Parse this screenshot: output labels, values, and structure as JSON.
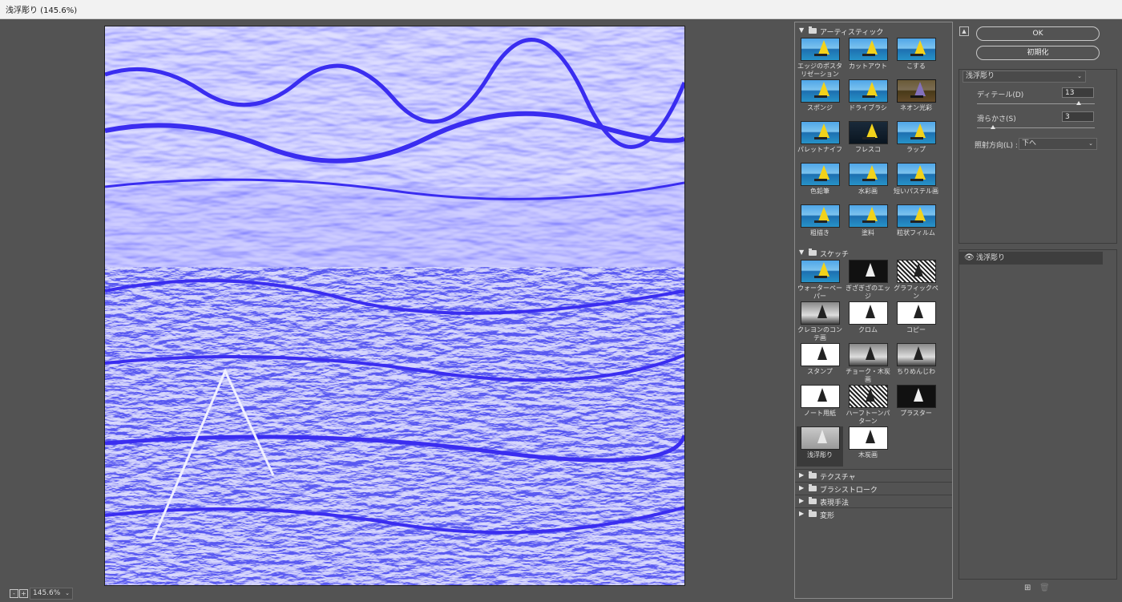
{
  "window": {
    "title": "浅浮彫り (145.6%)"
  },
  "preview": {
    "zoom": "145.6%",
    "minus": "-",
    "plus": "+"
  },
  "gallery": {
    "artistic": {
      "label": "アーティスティック",
      "items": [
        "エッジのポスタリゼーション",
        "カットアウト",
        "こする",
        "スポンジ",
        "ドライブラシ",
        "ネオン光彩",
        "パレットナイフ",
        "フレスコ",
        "ラップ",
        "色鉛筆",
        "水彩画",
        "短いパステル画",
        "粗描き",
        "塗料",
        "粒状フィルム"
      ]
    },
    "sketch": {
      "label": "スケッチ",
      "items": [
        "ウォーターペーパー",
        "ぎざぎざのエッジ",
        "グラフィックペン",
        "クレヨンのコンテ画",
        "クロム",
        "コピー",
        "スタンプ",
        "チョーク・木炭画",
        "ちりめんじわ",
        "ノート用紙",
        "ハーフトーンパターン",
        "プラスター",
        "浅浮彫り",
        "木炭画"
      ],
      "selected": "浅浮彫り"
    },
    "collapsed": [
      "テクスチャ",
      "ブラシストローク",
      "表現手法",
      "変形"
    ]
  },
  "panel": {
    "ok": "OK",
    "reset": "初期化",
    "filter": "浅浮彫り",
    "detail_label": "ディテール(D)",
    "detail_value": "13",
    "detail_fraction": 0.867,
    "smooth_label": "滑らかさ(S)",
    "smooth_value": "3",
    "smooth_fraction": 0.133,
    "light_label": "照射方向(L) :",
    "light_value": "下へ",
    "layer_name": "浅浮彫り",
    "collapse": "▲"
  },
  "colors": {
    "accent": "#3a2df0",
    "light": "#e6e6ff"
  }
}
